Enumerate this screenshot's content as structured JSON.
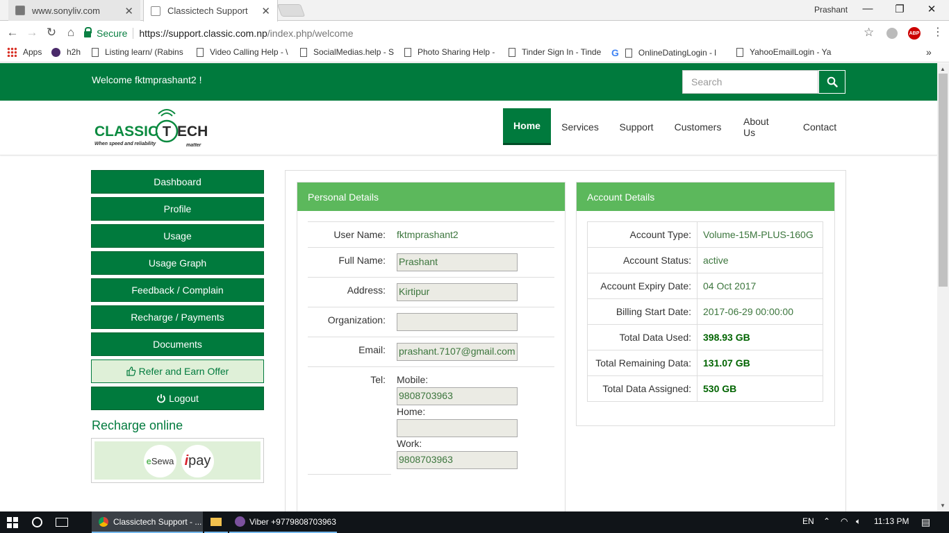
{
  "browser": {
    "tabs": [
      {
        "title": "www.sonyliv.com",
        "active": false
      },
      {
        "title": "Classictech Support",
        "active": true
      }
    ],
    "profile_name": "Prashant",
    "secure_label": "Secure",
    "url_host": "https://support.classic.com.np",
    "url_path": "/index.php/welcome",
    "bookmarks": [
      {
        "label": "Apps",
        "icon": "apps-grid-icon"
      },
      {
        "label": "h2h",
        "icon": "h2h-icon"
      },
      {
        "label": "Listing learn/ (Rabins",
        "icon": "page-icon"
      },
      {
        "label": "Video Calling Help - \\",
        "icon": "page-icon"
      },
      {
        "label": "SocialMedias.help - S",
        "icon": "page-icon"
      },
      {
        "label": "Photo Sharing Help -",
        "icon": "page-icon"
      },
      {
        "label": "Tinder Sign In - Tinde",
        "icon": "page-icon"
      },
      {
        "label": "OnlineDatingLogin - l",
        "icon": "google-icon"
      },
      {
        "label": "YahooEmailLogin - Ya",
        "icon": "page-icon"
      }
    ],
    "abp_label": "ABP"
  },
  "site": {
    "welcome": "Welcome fktmprashant2 !",
    "search_placeholder": "Search",
    "logo_text_left": "CLASSIC",
    "logo_text_right": "ECH",
    "logo_t": "T",
    "logo_tagline_left": "When speed and reliability",
    "logo_tagline_right": "matter",
    "nav": [
      "Home",
      "Services",
      "Support",
      "Customers",
      "About Us",
      "Contact"
    ],
    "sidebar": [
      "Dashboard",
      "Profile",
      "Usage",
      "Usage Graph",
      "Feedback / Complain",
      "Recharge / Payments",
      "Documents",
      "Refer and Earn Offer",
      "Logout"
    ],
    "recharge_title": "Recharge online",
    "esewa_label": "Sewa",
    "ipay_label": "pay",
    "colors": {
      "primary": "#007a3d",
      "panel_head": "#5cb85c",
      "value_text": "#3c763d"
    }
  },
  "personal": {
    "title": "Personal Details",
    "username_label": "User Name:",
    "username": "fktmprashant2",
    "fullname_label": "Full Name:",
    "fullname": "Prashant",
    "address_label": "Address:",
    "address": "Kirtipur",
    "organization_label": "Organization:",
    "organization": "",
    "email_label": "Email:",
    "email": "prashant.7107@gmail.com",
    "tel_label": "Tel:",
    "mobile_label": "Mobile:",
    "mobile": "9808703963",
    "home_label": "Home:",
    "home": "",
    "work_label": "Work:",
    "work": "9808703963"
  },
  "account": {
    "title": "Account Details",
    "rows": [
      {
        "label": "Account Type:",
        "value": "Volume-15M-PLUS-160G",
        "bold": false
      },
      {
        "label": "Account Status:",
        "value": "active",
        "bold": false
      },
      {
        "label": "Account Expiry Date:",
        "value": "04 Oct 2017",
        "bold": false
      },
      {
        "label": "Billing Start Date:",
        "value": "2017-06-29 00:00:00",
        "bold": false
      },
      {
        "label": "Total Data Used:",
        "value": "398.93 GB",
        "bold": true
      },
      {
        "label": "Total Remaining Data:",
        "value": "131.07 GB",
        "bold": true
      },
      {
        "label": "Total Data Assigned:",
        "value": "530 GB",
        "bold": true
      }
    ]
  },
  "taskbar": {
    "apps": [
      {
        "label": "Classictech Support - ...",
        "active": true
      },
      {
        "label": "",
        "active": false
      },
      {
        "label": "Viber +9779808703963",
        "active": false
      }
    ],
    "lang": "EN",
    "time": "11:13 PM"
  }
}
